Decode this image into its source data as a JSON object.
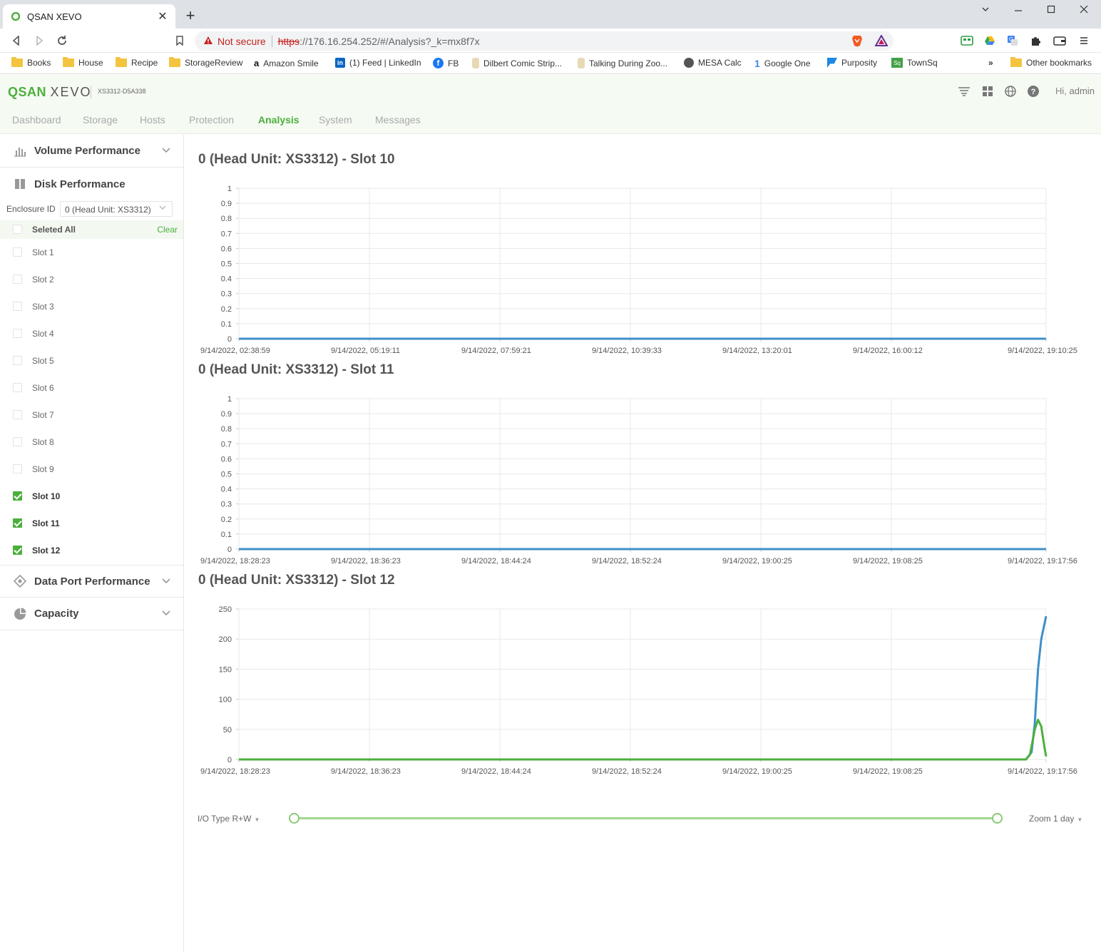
{
  "browser": {
    "tab_title": "QSAN XEVO",
    "tab_close": "✕",
    "new_tab": "+",
    "security_label": "Not secure",
    "url_scheme": "https",
    "url_rest": "://176.16.254.252/#/Analysis?_k=mx8f7x",
    "bookmarks": [
      "Books",
      "House",
      "Recipe",
      "StorageReview",
      "Amazon Smile",
      "(1) Feed | LinkedIn",
      "FB",
      "Dilbert Comic Strip...",
      "Talking During Zoo...",
      "MESA Calc",
      "Google One",
      "Purposity",
      "TownSq"
    ],
    "more_bookmarks": "»",
    "other_bookmarks": "Other bookmarks",
    "colors": {
      "accent": "#4caf3c",
      "warning": "#c5221f"
    }
  },
  "app": {
    "logo_brand": "QSAN",
    "logo_product": "XEVO",
    "device_id": "XS3312-D5A338",
    "greeting": "Hi,",
    "user": "admin",
    "nav": [
      "Dashboard",
      "Storage",
      "Hosts",
      "Protection",
      "Analysis",
      "System",
      "Messages"
    ],
    "active_nav": "Analysis"
  },
  "sidebar": {
    "volume_performance": "Volume Performance",
    "disk_performance": "Disk Performance",
    "enclosure_label": "Enclosure ID",
    "enclosure_value": "0 (Head Unit: XS3312)",
    "selected_all": "Seleted All",
    "clear": "Clear",
    "slots": [
      {
        "label": "Slot 1",
        "checked": false
      },
      {
        "label": "Slot 2",
        "checked": false
      },
      {
        "label": "Slot 3",
        "checked": false
      },
      {
        "label": "Slot 4",
        "checked": false
      },
      {
        "label": "Slot 5",
        "checked": false
      },
      {
        "label": "Slot 6",
        "checked": false
      },
      {
        "label": "Slot 7",
        "checked": false
      },
      {
        "label": "Slot 8",
        "checked": false
      },
      {
        "label": "Slot 9",
        "checked": false
      },
      {
        "label": "Slot 10",
        "checked": true
      },
      {
        "label": "Slot 11",
        "checked": true
      },
      {
        "label": "Slot 12",
        "checked": true
      }
    ],
    "data_port_performance": "Data Port Performance",
    "capacity": "Capacity"
  },
  "controls": {
    "io_type": "I/O Type R+W",
    "zoom": "Zoom 1 day",
    "range_start": 0,
    "range_end": 1
  },
  "chart_data": [
    {
      "type": "line",
      "title": "0 (Head Unit: XS3312) - Slot 10",
      "x": [
        "9/14/2022, 02:38:59",
        "9/14/2022, 05:19:11",
        "9/14/2022, 07:59:21",
        "9/14/2022, 10:39:33",
        "9/14/2022, 13:20:01",
        "9/14/2022, 16:00:12",
        "9/14/2022, 19:10:25"
      ],
      "yticks": [
        "0",
        "0.1",
        "0.2",
        "0.3",
        "0.4",
        "0.5",
        "0.6",
        "0.7",
        "0.8",
        "0.9",
        "1"
      ],
      "ylim": [
        0,
        1
      ],
      "grid": true,
      "series": [
        {
          "color": "#3d8fc9",
          "values": [
            0,
            0,
            0,
            0,
            0,
            0,
            0
          ]
        }
      ]
    },
    {
      "type": "line",
      "title": "0 (Head Unit: XS3312) - Slot 11",
      "x": [
        "9/14/2022, 18:28:23",
        "9/14/2022, 18:36:23",
        "9/14/2022, 18:44:24",
        "9/14/2022, 18:52:24",
        "9/14/2022, 19:00:25",
        "9/14/2022, 19:08:25",
        "9/14/2022, 19:17:56"
      ],
      "yticks": [
        "0",
        "0.1",
        "0.2",
        "0.3",
        "0.4",
        "0.5",
        "0.6",
        "0.7",
        "0.8",
        "0.9",
        "1"
      ],
      "ylim": [
        0,
        1
      ],
      "grid": true,
      "series": [
        {
          "color": "#3d8fc9",
          "values": [
            0,
            0,
            0,
            0,
            0,
            0,
            0
          ]
        }
      ]
    },
    {
      "type": "line",
      "title": "0 (Head Unit: XS3312) - Slot 12",
      "x": [
        "9/14/2022, 18:28:23",
        "9/14/2022, 18:36:23",
        "9/14/2022, 18:44:24",
        "9/14/2022, 18:52:24",
        "9/14/2022, 19:00:25",
        "9/14/2022, 19:08:25",
        "9/14/2022, 19:17:56"
      ],
      "yticks": [
        "0",
        "50",
        "100",
        "150",
        "200",
        "250"
      ],
      "ylim": [
        0,
        250
      ],
      "grid": true,
      "series": [
        {
          "color": "#3d8fc9",
          "points": [
            [
              0,
              0
            ],
            [
              0.975,
              0
            ],
            [
              0.982,
              12
            ],
            [
              0.986,
              60
            ],
            [
              0.99,
              150
            ],
            [
              0.994,
              200
            ],
            [
              1,
              238
            ]
          ]
        },
        {
          "color": "#4caf3c",
          "points": [
            [
              0,
              0
            ],
            [
              0.975,
              0
            ],
            [
              0.98,
              8
            ],
            [
              0.986,
              50
            ],
            [
              0.99,
              66
            ],
            [
              0.994,
              55
            ],
            [
              0.998,
              20
            ],
            [
              1,
              5
            ]
          ]
        }
      ]
    }
  ]
}
